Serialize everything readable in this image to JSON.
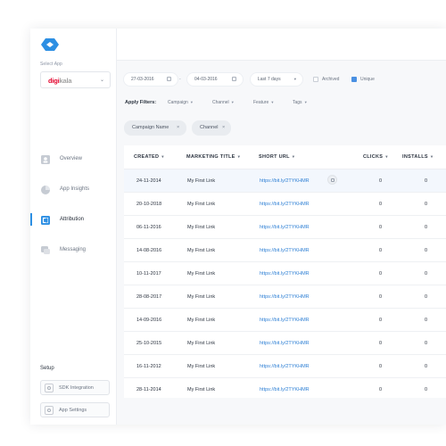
{
  "sidebar": {
    "select_app_label": "Select App",
    "app": {
      "brand_main": "digi",
      "brand_accent": "kala"
    },
    "nav": [
      {
        "label": "Overview",
        "icon": "user-icon"
      },
      {
        "label": "App Insights",
        "icon": "pie-chart-icon"
      },
      {
        "label": "Attribution",
        "icon": "attribution-icon",
        "active": true
      },
      {
        "label": "Messaging",
        "icon": "chat-icon"
      }
    ],
    "setup_label": "Setup",
    "setup_buttons": [
      {
        "label": "SDK Integration",
        "icon": "sdk-icon"
      },
      {
        "label": "App Settings",
        "icon": "settings-icon"
      }
    ]
  },
  "filters": {
    "date_from": "27-03-2016",
    "date_to": "04-03-2016",
    "range": "Last 7 days",
    "archived_label": "Archived",
    "unique_label": "Unique",
    "unique_checked": true,
    "archived_checked": false,
    "apply_label": "Apply Filters:",
    "options": [
      "Campaign",
      "Channel",
      "Feature",
      "Tags"
    ],
    "chips": [
      "Campaign Name",
      "Channel"
    ]
  },
  "table": {
    "headers": [
      "CREATED",
      "MARKETING TITLE",
      "SHORT URL",
      "CLICKS",
      "INSTALLS"
    ],
    "rows": [
      {
        "created": "24-11-2014",
        "title": "My First Link",
        "url": "https://bit.ly/2TYKHMR",
        "clicks": "0",
        "installs": "0"
      },
      {
        "created": "20-10-2018",
        "title": "My First Link",
        "url": "https://bit.ly/2TYKHMR",
        "clicks": "0",
        "installs": "0"
      },
      {
        "created": "06-11-2016",
        "title": "My First Link",
        "url": "https://bit.ly/2TYKHMR",
        "clicks": "0",
        "installs": "0"
      },
      {
        "created": "14-08-2016",
        "title": "My First Link",
        "url": "https://bit.ly/2TYKHMR",
        "clicks": "0",
        "installs": "0"
      },
      {
        "created": "10-11-2017",
        "title": "My First Link",
        "url": "https://bit.ly/2TYKHMR",
        "clicks": "0",
        "installs": "0"
      },
      {
        "created": "28-08-2017",
        "title": "My First Link",
        "url": "https://bit.ly/2TYKHMR",
        "clicks": "0",
        "installs": "0"
      },
      {
        "created": "14-09-2016",
        "title": "My First Link",
        "url": "https://bit.ly/2TYKHMR",
        "clicks": "0",
        "installs": "0"
      },
      {
        "created": "25-10-2015",
        "title": "My First Link",
        "url": "https://bit.ly/2TYKHMR",
        "clicks": "0",
        "installs": "0"
      },
      {
        "created": "16-11-2012",
        "title": "My First Link",
        "url": "https://bit.ly/2TYKHMR",
        "clicks": "0",
        "installs": "0"
      },
      {
        "created": "28-11-2014",
        "title": "My First Link",
        "url": "https://bit.ly/2TYKHMR",
        "clicks": "0",
        "installs": "0"
      }
    ]
  },
  "colors": {
    "accent": "#2d8fe3",
    "brand": "#e2002b",
    "link": "#2d7fd4"
  }
}
